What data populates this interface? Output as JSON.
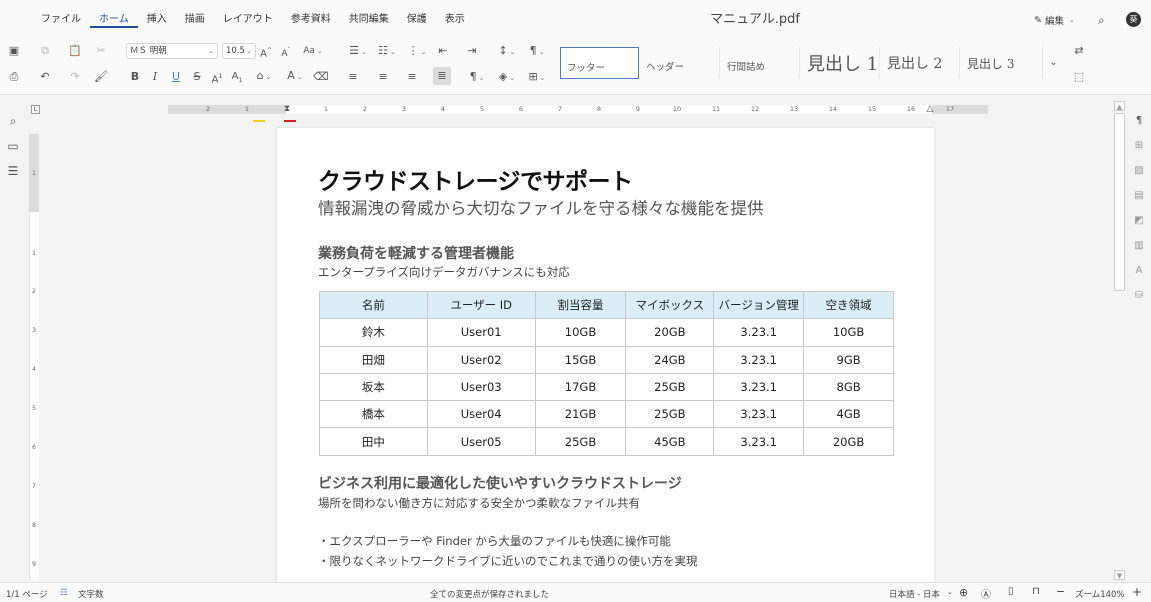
{
  "menu": {
    "items": [
      "ファイル",
      "ホーム",
      "挿入",
      "描画",
      "レイアウト",
      "参考資料",
      "共同編集",
      "保護",
      "表示"
    ],
    "active_index": 1
  },
  "title": "マニュアル.pdf",
  "topright": {
    "edit_label": "編集",
    "avatar_text": "葵"
  },
  "toolbar": {
    "font_name": "ＭＳ 明朝",
    "font_size": "10.5",
    "styles": [
      "フッター",
      "ヘッダー",
      "行間詰め",
      "見出し 1",
      "見出し 2",
      "見出し 3"
    ],
    "selected_style_index": 0,
    "highlight_color": "#f2d21b",
    "font_color": "#d11f1f"
  },
  "document": {
    "heading": "クラウドストレージでサポート",
    "subheading": "情報漏洩の脅威から大切なファイルを守る様々な機能を提供",
    "section1": {
      "title": "業務負荷を軽減する管理者機能",
      "subtitle": "エンタープライズ向けデータガバナンスにも対応"
    },
    "table": {
      "headers": [
        "名前",
        "ユーザー ID",
        "割当容量",
        "マイボックス",
        "バージョン管理",
        "空き領域"
      ],
      "rows": [
        [
          "鈴木",
          "User01",
          "10GB",
          "20GB",
          "3.23.1",
          "10GB"
        ],
        [
          "田畑",
          "User02",
          "15GB",
          "24GB",
          "3.23.1",
          "9GB"
        ],
        [
          "坂本",
          "User03",
          "17GB",
          "25GB",
          "3.23.1",
          "8GB"
        ],
        [
          "橋本",
          "User04",
          "21GB",
          "25GB",
          "3.23.1",
          "4GB"
        ],
        [
          "田中",
          "User05",
          "25GB",
          "45GB",
          "3.23.1",
          "20GB"
        ]
      ],
      "header_bg": "#dbeef8"
    },
    "section2": {
      "title": "ビジネス利用に最適化した使いやすいクラウドストレージ",
      "subtitle": "場所を問わない働き方に対応する安全かつ柔軟なファイル共有"
    },
    "bullets": [
      "・エクスプローラーや Finder から大量のファイルも快適に操作可能",
      "・限りなくネットワークドライブに近いのでこれまで通りの使い方を実現"
    ]
  },
  "status": {
    "page": "1/1 ページ",
    "word_count": "文字数",
    "saved": "全ての変更点が保存されました",
    "language": "日本語 - 日本",
    "zoom": "ズーム140%"
  },
  "accent": "#1f4e9c"
}
